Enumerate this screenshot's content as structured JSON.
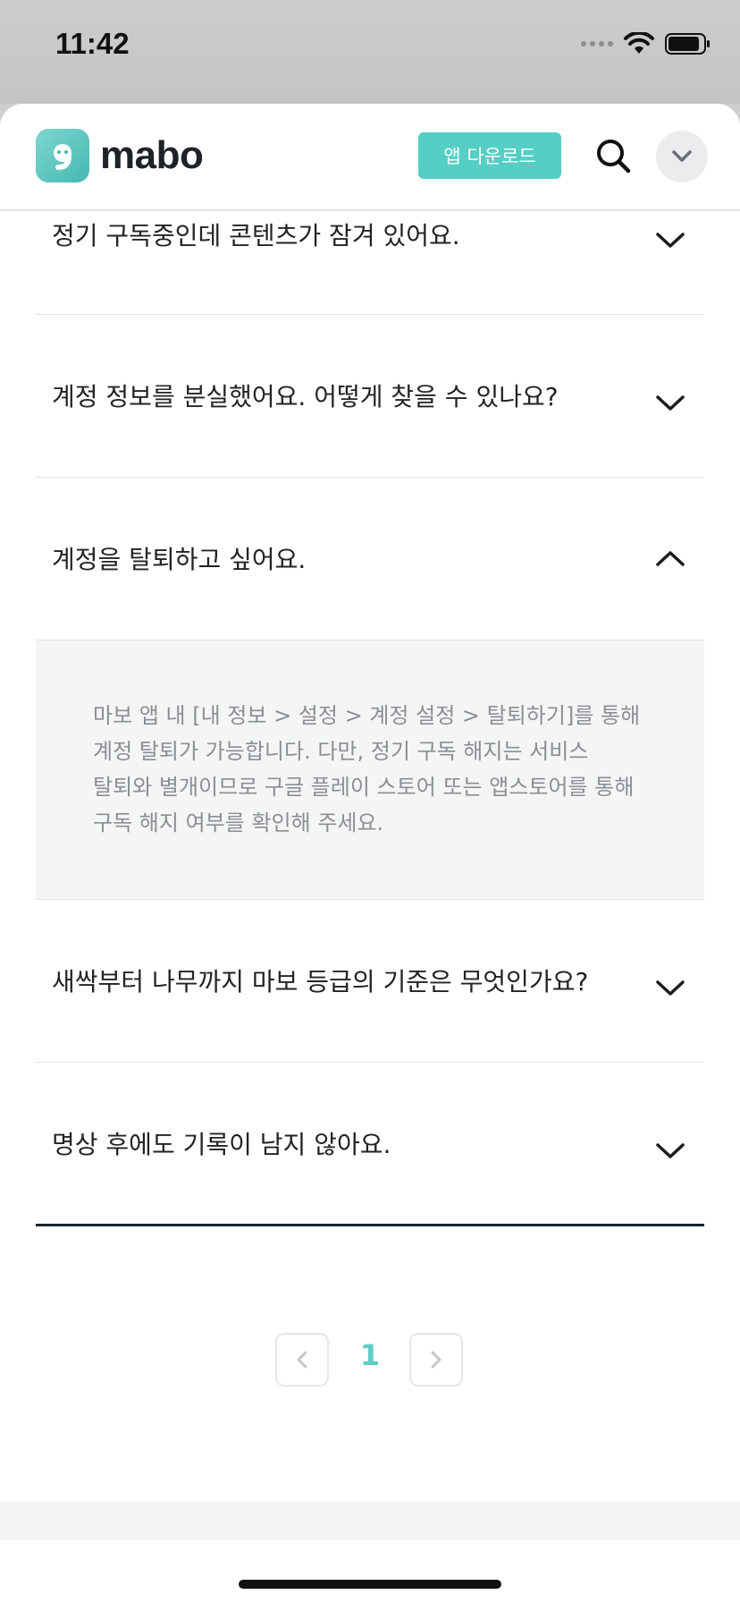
{
  "status_bar": {
    "time": "11:42"
  },
  "header": {
    "logo_text": "mabo",
    "download_label": "앱 다운로드"
  },
  "faq": {
    "items": [
      {
        "question": "정기 구독중인데 콘텐츠가 잠겨 있어요.",
        "expanded": false
      },
      {
        "question": "계정 정보를 분실했어요. 어떻게 찾을 수 있나요?",
        "expanded": false
      },
      {
        "question": "계정을 탈퇴하고 싶어요.",
        "expanded": true,
        "answer": "마보 앱 내 [내 정보 > 설정 > 계정 설정 > 탈퇴하기]를 통해 계정 탈퇴가 가능합니다. 다만, 정기 구독 해지는 서비스 탈퇴와 별개이므로 구글 플레이 스토어 또는 앱스토어를 통해 구독 해지 여부를 확인해 주세요."
      },
      {
        "question": "새싹부터 나무까지 마보 등급의 기준은 무엇인가요?",
        "expanded": false
      },
      {
        "question": "명상 후에도 기록이 남지 않아요.",
        "expanded": false
      }
    ]
  },
  "pagination": {
    "current_page": "1"
  },
  "colors": {
    "accent": "#55cec6",
    "page_number": "#5fcdc4",
    "answer_bg": "#f4f5f5"
  }
}
